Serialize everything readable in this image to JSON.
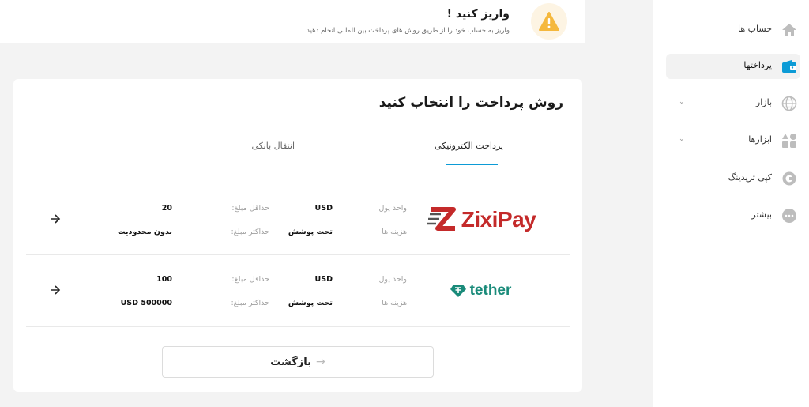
{
  "alert": {
    "title": "واریز کنید !",
    "subtitle": "واریز به حساب خود را از طریق روش های پرداخت بین المللی انجام دهید",
    "icon": "warning-icon"
  },
  "sidebar": {
    "items": [
      {
        "label": "حساب ها",
        "icon": "home-icon",
        "active": false
      },
      {
        "label": "پرداختها",
        "icon": "wallet-icon",
        "active": true
      },
      {
        "label": "بازار",
        "icon": "globe-icon",
        "active": false,
        "expandable": true
      },
      {
        "label": "ابزارها",
        "icon": "tools-icon",
        "active": false,
        "expandable": true
      },
      {
        "label": "کپی تریدینگ",
        "icon": "copy-trading-icon",
        "active": false
      },
      {
        "label": "بیشتر",
        "icon": "more-icon",
        "active": false
      }
    ]
  },
  "main": {
    "title": "روش پرداخت را انتخاب کنید",
    "tabs": [
      {
        "label": "پرداخت الکترونیکی",
        "active": true
      },
      {
        "label": "انتقال بانکی",
        "active": false
      }
    ],
    "methods": [
      {
        "logo": "ZixiPay",
        "currency_label": "واحد پول",
        "currency_value": "USD",
        "fees_label": "هزینه ها",
        "fees_value": "تحت پوشش",
        "min_label": "حداقل مبلغ:",
        "min_value": "20",
        "max_label": "حداکثر مبلغ:",
        "max_value": "بدون محدودیت"
      },
      {
        "logo": "tether",
        "currency_label": "واحد پول",
        "currency_value": "USD",
        "fees_label": "هزینه ها",
        "fees_value": "تحت پوشش",
        "min_label": "حداقل مبلغ:",
        "min_value": "100",
        "max_label": "حداکثر مبلغ:",
        "max_value": "USD 500000"
      }
    ],
    "back_label": "بازگشت"
  },
  "colors": {
    "accent": "#0c9bd6",
    "warning": "#f5b83d",
    "zixipay": "#c42a2a",
    "tether": "#1a8b7a"
  }
}
